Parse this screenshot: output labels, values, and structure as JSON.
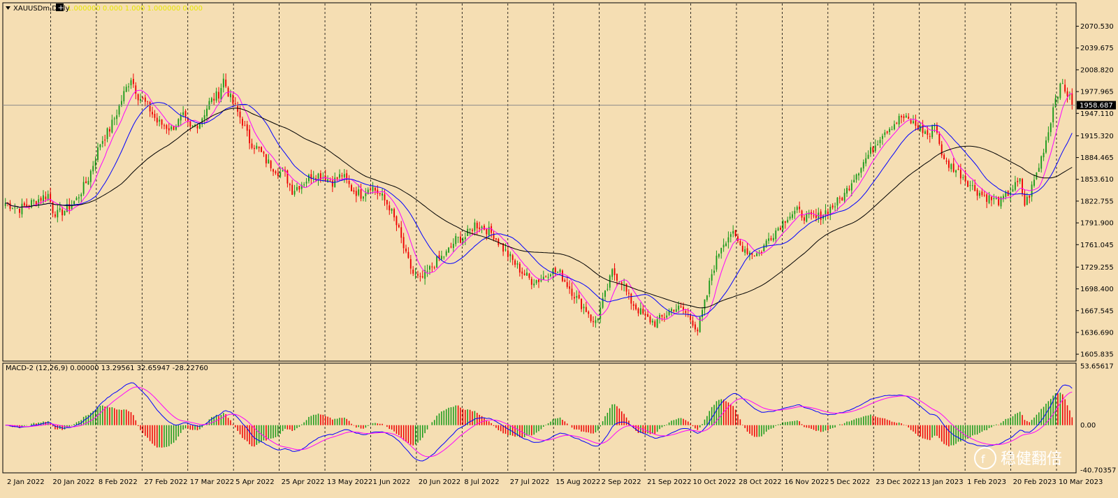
{
  "header": {
    "symbol_label": "XAUUSDm,Daily",
    "plus_label": "+",
    "overlay_text": "1.000000 0.000 1.000 1.000000 0.000"
  },
  "macd_header": "MACD-2 (12,26,9) 0.00000 13.29561 32.65947 -28.22760",
  "current_price": "1958.687",
  "watermark": "稳健翻倍",
  "colors": {
    "background": "#f5deb3",
    "bull": "#1a9a1a",
    "bear": "#ee0000",
    "ma_fast": "#ff00ff",
    "ma_mid": "#0000ff",
    "ma_slow": "#000000",
    "macd_line": "#0000ff",
    "signal_line": "#ff00ff"
  },
  "chart_data": [
    {
      "type": "candlestick",
      "title": "XAUUSDm,Daily",
      "y_ticks": [
        "2070.530",
        "2039.675",
        "2008.820",
        "1977.965",
        "1947.110",
        "1915.320",
        "1884.465",
        "1853.610",
        "1822.755",
        "1791.900",
        "1761.045",
        "1729.255",
        "1698.400",
        "1667.545",
        "1636.690",
        "1605.835"
      ],
      "ylim": [
        1600,
        2080
      ],
      "x_ticks": [
        "2 Jan 2022",
        "20 Jan 2022",
        "8 Feb 2022",
        "27 Feb 2022",
        "17 Mar 2022",
        "5 Apr 2022",
        "25 Apr 2022",
        "13 May 2022",
        "1 Jun 2022",
        "20 Jun 2022",
        "8 Jul 2022",
        "27 Jul 2022",
        "15 Aug 2022",
        "2 Sep 2022",
        "21 Sep 2022",
        "10 Oct 2022",
        "28 Oct 2022",
        "16 Nov 2022",
        "5 Dec 2022",
        "23 Dec 2022",
        "13 Jan 2023",
        "1 Feb 2023",
        "20 Feb 2023",
        "10 Mar 2023"
      ],
      "current_price": 1958.687,
      "price_path": [
        [
          0,
          1820
        ],
        [
          6,
          1812
        ],
        [
          12,
          1822
        ],
        [
          18,
          1832
        ],
        [
          20,
          1810
        ],
        [
          22,
          1804
        ],
        [
          26,
          1812
        ],
        [
          30,
          1825
        ],
        [
          35,
          1855
        ],
        [
          40,
          1905
        ],
        [
          44,
          1925
        ],
        [
          47,
          1948
        ],
        [
          50,
          1975
        ],
        [
          53,
          1998
        ],
        [
          56,
          1972
        ],
        [
          60,
          1958
        ],
        [
          64,
          1935
        ],
        [
          70,
          1925
        ],
        [
          75,
          1942
        ],
        [
          78,
          1925
        ],
        [
          82,
          1935
        ],
        [
          86,
          1962
        ],
        [
          90,
          1975
        ],
        [
          92,
          1995
        ],
        [
          95,
          1968
        ],
        [
          100,
          1935
        ],
        [
          103,
          1908
        ],
        [
          107,
          1895
        ],
        [
          110,
          1880
        ],
        [
          115,
          1865
        ],
        [
          118,
          1860
        ],
        [
          121,
          1838
        ],
        [
          126,
          1850
        ],
        [
          130,
          1862
        ],
        [
          134,
          1858
        ],
        [
          138,
          1850
        ],
        [
          142,
          1860
        ],
        [
          146,
          1840
        ],
        [
          150,
          1832
        ],
        [
          154,
          1845
        ],
        [
          158,
          1832
        ],
        [
          162,
          1815
        ],
        [
          166,
          1780
        ],
        [
          169,
          1745
        ],
        [
          172,
          1720
        ],
        [
          175,
          1710
        ],
        [
          178,
          1722
        ],
        [
          182,
          1738
        ],
        [
          186,
          1748
        ],
        [
          190,
          1768
        ],
        [
          194,
          1772
        ],
        [
          198,
          1790
        ],
        [
          202,
          1785
        ],
        [
          206,
          1775
        ],
        [
          210,
          1755
        ],
        [
          214,
          1738
        ],
        [
          218,
          1722
        ],
        [
          222,
          1710
        ],
        [
          226,
          1712
        ],
        [
          230,
          1725
        ],
        [
          234,
          1720
        ],
        [
          238,
          1700
        ],
        [
          242,
          1680
        ],
        [
          246,
          1665
        ],
        [
          248,
          1648
        ],
        [
          250,
          1660
        ],
        [
          252,
          1680
        ],
        [
          254,
          1700
        ],
        [
          256,
          1722
        ],
        [
          260,
          1710
        ],
        [
          263,
          1685
        ],
        [
          266,
          1672
        ],
        [
          270,
          1658
        ],
        [
          274,
          1650
        ],
        [
          278,
          1660
        ],
        [
          282,
          1672
        ],
        [
          286,
          1668
        ],
        [
          290,
          1652
        ],
        [
          292,
          1640
        ],
        [
          294,
          1665
        ],
        [
          296,
          1690
        ],
        [
          298,
          1720
        ],
        [
          302,
          1760
        ],
        [
          306,
          1778
        ],
        [
          310,
          1760
        ],
        [
          314,
          1750
        ],
        [
          318,
          1748
        ],
        [
          322,
          1770
        ],
        [
          326,
          1785
        ],
        [
          330,
          1802
        ],
        [
          334,
          1808
        ],
        [
          338,
          1800
        ],
        [
          342,
          1798
        ],
        [
          346,
          1808
        ],
        [
          350,
          1818
        ],
        [
          354,
          1832
        ],
        [
          358,
          1858
        ],
        [
          362,
          1878
        ],
        [
          366,
          1898
        ],
        [
          370,
          1920
        ],
        [
          374,
          1930
        ],
        [
          378,
          1942
        ],
        [
          382,
          1935
        ],
        [
          386,
          1925
        ],
        [
          390,
          1915
        ],
        [
          392,
          1935
        ],
        [
          394,
          1905
        ],
        [
          396,
          1878
        ],
        [
          400,
          1870
        ],
        [
          404,
          1858
        ],
        [
          408,
          1842
        ],
        [
          412,
          1832
        ],
        [
          416,
          1825
        ],
        [
          420,
          1822
        ],
        [
          424,
          1838
        ],
        [
          428,
          1850
        ],
        [
          430,
          1818
        ],
        [
          432,
          1832
        ],
        [
          436,
          1872
        ],
        [
          440,
          1922
        ],
        [
          443,
          1972
        ],
        [
          446,
          1988
        ],
        [
          448,
          1975
        ],
        [
          450,
          1960
        ]
      ],
      "series": [
        {
          "name": "MA fast",
          "color": "#ff00ff"
        },
        {
          "name": "MA mid",
          "color": "#0000ff"
        },
        {
          "name": "MA slow",
          "color": "#000000"
        }
      ]
    },
    {
      "type": "bar",
      "title": "MACD-2 (12,26,9) 0.00000 13.29561 32.65947 -28.22760",
      "y_ticks": [
        "53.65617",
        "0.00",
        "-40.70357"
      ],
      "ylim": [
        -40.70357,
        53.65617
      ],
      "series": [
        {
          "name": "MACD",
          "color": "#0000ff"
        },
        {
          "name": "Signal",
          "color": "#ff00ff"
        },
        {
          "name": "Histogram",
          "color": "#1a9a1a"
        }
      ]
    }
  ]
}
